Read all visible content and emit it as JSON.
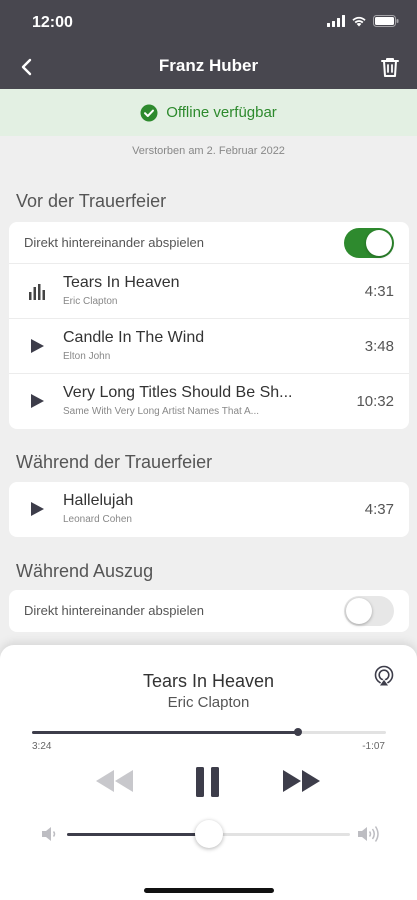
{
  "status_bar": {
    "time": "12:00"
  },
  "header": {
    "title": "Franz Huber"
  },
  "offline_banner": {
    "text": "Offline verfügbar"
  },
  "deceased_text": "Verstorben am 2. Februar 2022",
  "sections": [
    {
      "title": "Vor der Trauerfeier",
      "autoplay": {
        "label": "Direkt hintereinander abspielen",
        "on": true
      },
      "tracks": [
        {
          "title": "Tears In Heaven",
          "artist": "Eric Clapton",
          "duration": "4:31",
          "state": "playing"
        },
        {
          "title": "Candle In The Wind",
          "artist": "Elton John",
          "duration": "3:48",
          "state": "idle"
        },
        {
          "title": "Very Long Titles Should Be Sh...",
          "artist": "Same With Very Long Artist Names That A...",
          "duration": "10:32",
          "state": "idle"
        }
      ]
    },
    {
      "title": "Während der Trauerfeier",
      "tracks": [
        {
          "title": "Hallelujah",
          "artist": "Leonard Cohen",
          "duration": "4:37",
          "state": "idle"
        }
      ]
    },
    {
      "title": "Während Auszug",
      "autoplay": {
        "label": "Direkt hintereinander abspielen",
        "on": false
      }
    }
  ],
  "player": {
    "title": "Tears In Heaven",
    "artist": "Eric Clapton",
    "elapsed": "3:24",
    "remaining": "-1:07",
    "progress": 0.75,
    "volume": 0.5
  },
  "colors": {
    "header_bg": "#48474f",
    "accent_green": "#2e8a2e",
    "dark_control": "#3d3d4a"
  },
  "icons": {
    "back": "chevron-left-icon",
    "delete": "trash-icon",
    "offline": "check-circle-icon",
    "playing": "equalizer-bars-icon",
    "play": "play-icon",
    "airplay": "airplay-icon",
    "rewind": "rewind-icon",
    "pause": "pause-icon",
    "forward": "fast-forward-icon",
    "volume_low": "speaker-low-icon",
    "volume_high": "speaker-high-icon"
  }
}
